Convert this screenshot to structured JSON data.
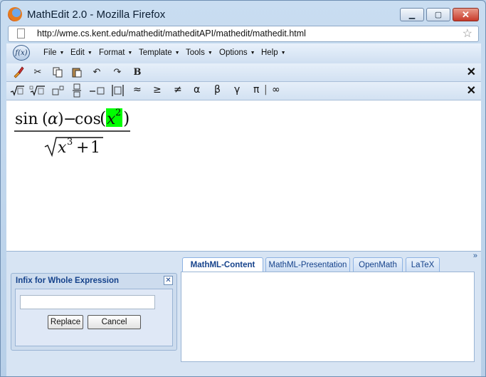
{
  "window": {
    "title": "MathEdit 2.0 - Mozilla Firefox",
    "url": "http://wme.cs.kent.edu/mathedit/matheditAPI/mathedit/mathedit.html",
    "controls": [
      "minimize",
      "maximize",
      "close"
    ]
  },
  "app": {
    "logo_text": "f(x)",
    "menus": [
      {
        "label": "File"
      },
      {
        "label": "Edit"
      },
      {
        "label": "Format"
      },
      {
        "label": "Template"
      },
      {
        "label": "Tools"
      },
      {
        "label": "Options"
      },
      {
        "label": "Help"
      }
    ],
    "toolbar1": {
      "icons": [
        "brush-icon",
        "cut-icon",
        "copy-icon",
        "paste-icon",
        "undo-icon",
        "redo-icon",
        "bold-icon"
      ],
      "bold_label": "B",
      "close_label": "✕"
    },
    "toolbar2": {
      "symbols": [
        "≈",
        "≥",
        "≠",
        "α",
        "β",
        "γ",
        "π"
      ],
      "infinity": "∞",
      "close_label": "✕"
    }
  },
  "expression": {
    "numerator": {
      "sin": "sin",
      "arg1": "α",
      "minus": "−",
      "cos": "cos",
      "var": "x",
      "exp": "2"
    },
    "denominator": {
      "var": "x",
      "exp": "3",
      "plus": "+",
      "const": "1"
    },
    "highlight_color": "#00ff00"
  },
  "infix_panel": {
    "title": "Infix for Whole Expression",
    "input_value": "",
    "replace_label": "Replace",
    "cancel_label": "Cancel"
  },
  "tabs": [
    {
      "label": "MathML-Content",
      "active": true
    },
    {
      "label": "MathML-Presentation",
      "active": false
    },
    {
      "label": "OpenMath",
      "active": false
    },
    {
      "label": "LaTeX",
      "active": false
    }
  ],
  "collapse_label": "»"
}
